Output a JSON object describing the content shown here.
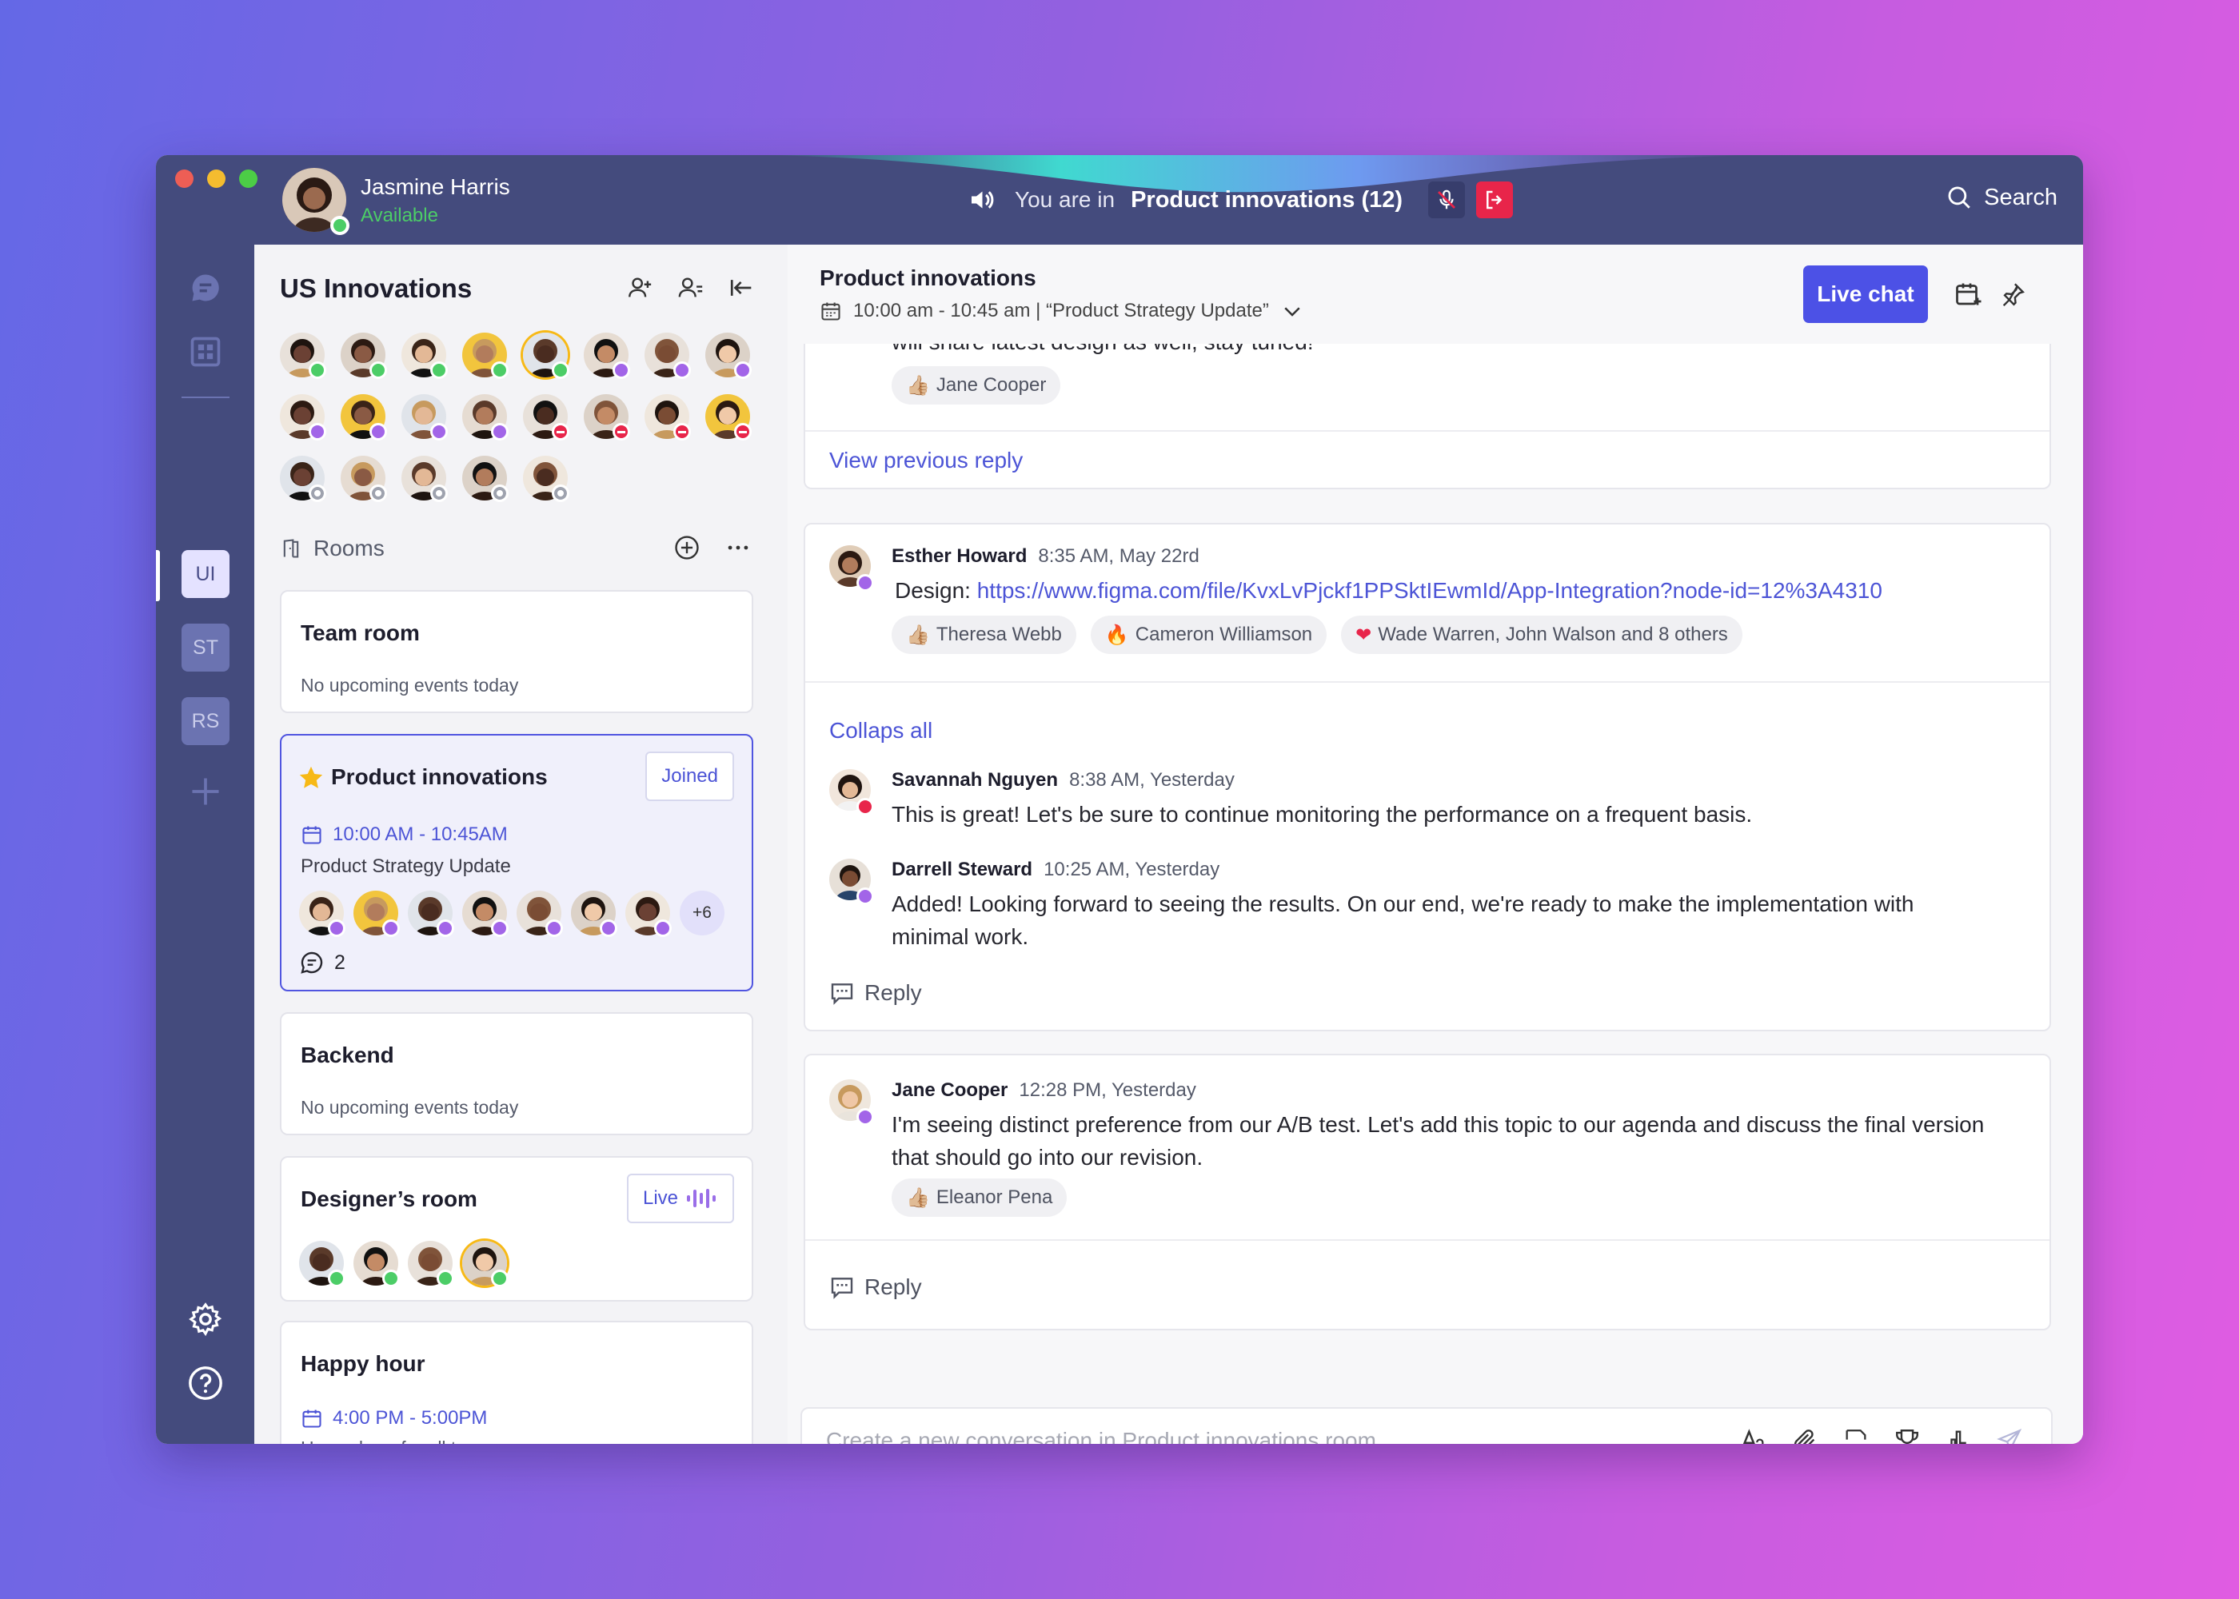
{
  "user": {
    "name": "Jasmine Harris",
    "status": "Available"
  },
  "call": {
    "prefix": "You are in",
    "room": "Product innovations (12)"
  },
  "search": {
    "label": "Search"
  },
  "workspaces": [
    "UI",
    "ST",
    "RS"
  ],
  "panel": {
    "title": "US Innovations",
    "rooms_label": "Rooms"
  },
  "rooms": [
    {
      "title": "Team room",
      "subtitle": "No upcoming events today"
    },
    {
      "title": "Product innovations",
      "tag": "Joined",
      "time": "10:00 AM - 10:45AM",
      "subtitle": "Product Strategy Update",
      "more": "+6",
      "comments": "2"
    },
    {
      "title": "Backend",
      "subtitle": "No upcoming events today"
    },
    {
      "title": "Designer’s room",
      "tag": "Live"
    },
    {
      "title": "Happy hour",
      "time": "4:00 PM - 5:00PM",
      "subtitle": "Happy hour for all team"
    }
  ],
  "header": {
    "title": "Product innovations",
    "subtitle": "10:00 am - 10:45 am | “Product Strategy Update”",
    "live_chat": "Live chat"
  },
  "thread1": {
    "partial_text": "will share latest design as well, stay tuned!",
    "reaction": "Jane Cooper",
    "view_prev": "View previous reply"
  },
  "thread2": {
    "author": "Esther Howard",
    "time": "8:35 AM, May 22rd",
    "prefix": "Design: ",
    "link": "https://www.figma.com/file/KvxLvPjckf1PPSktIEwmId/App-Integration?node-id=12%3A4310",
    "reactions": [
      "Theresa Webb",
      "Cameron Williamson",
      "Wade Warren, John Walson and 8 others"
    ],
    "collapse": "Collaps all",
    "replies": [
      {
        "author": "Savannah Nguyen",
        "time": "8:38 AM, Yesterday",
        "text": "This is great! Let's be sure to continue monitoring the performance on a frequent basis."
      },
      {
        "author": "Darrell Steward",
        "time": "10:25 AM, Yesterday",
        "text": "Added! Looking forward to seeing the results. On our end, we're ready to make the implementation with minimal work."
      }
    ],
    "reply": "Reply"
  },
  "thread3": {
    "author": "Jane Cooper",
    "time": "12:28 PM, Yesterday",
    "text": "I'm seeing distinct preference from our A/B test. Let's add this topic to our agenda and discuss the final version that should go into our revision.",
    "reaction": "Eleanor Pena",
    "reply": "Reply"
  },
  "composer": {
    "placeholder": "Create a new conversation in Product innovations room"
  },
  "colors": {
    "accent": "#4c51e6",
    "sidebar": "#444b7d",
    "online": "#4ccd67",
    "busy": "#e8254a",
    "away": "#a265e8"
  }
}
